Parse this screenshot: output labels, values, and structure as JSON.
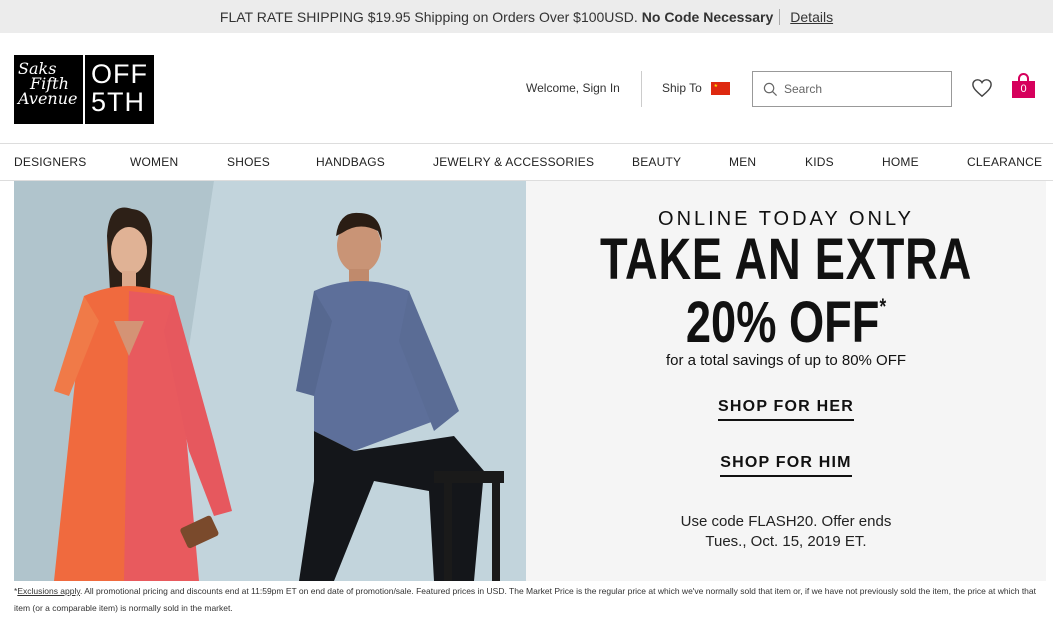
{
  "promo_bar": {
    "text": "FLAT RATE SHIPPING $19.95 Shipping on Orders Over $100USD.",
    "strong": "No Code Necessary",
    "details": "Details"
  },
  "logo": {
    "saks_line1": "Saks",
    "saks_line2": "Fifth",
    "saks_line3": "Avenue",
    "off_line1": "OFF",
    "off_line2": "5TH"
  },
  "header": {
    "welcome": "Welcome, Sign In",
    "ship_to": "Ship To",
    "search_placeholder": "Search",
    "bag_count": "0"
  },
  "nav": [
    "DESIGNERS",
    "WOMEN",
    "SHOES",
    "HANDBAGS",
    "JEWELRY & ACCESSORIES",
    "BEAUTY",
    "MEN",
    "KIDS",
    "HOME",
    "CLEARANCE"
  ],
  "hero": {
    "eyebrow": "ONLINE TODAY ONLY",
    "headline1": "TAKE AN EXTRA",
    "headline2": "20% OFF",
    "asterisk": "*",
    "savings": "for a total savings of up to 80% OFF",
    "shop_her": "SHOP FOR HER",
    "shop_him": "SHOP FOR HIM",
    "code_line1": "Use code FLASH20. Offer ends",
    "code_line2": "Tues., Oct. 15, 2019 ET."
  },
  "disclaimer": {
    "prefix": "*",
    "link": "Exclusions apply",
    "text": ". All promotional pricing and discounts end at 11:59pm ET on end date of promotion/sale. Featured prices in USD. The Market Price is the regular price at which we've normally sold that item or, if we have not previously sold the item, the price at which that item (or a comparable item) is normally sold in the market."
  },
  "colors": {
    "accent": "#d6005c",
    "promo_bg": "#ececec",
    "hero_bg": "#f5f5f5",
    "flag": "#de2910"
  }
}
